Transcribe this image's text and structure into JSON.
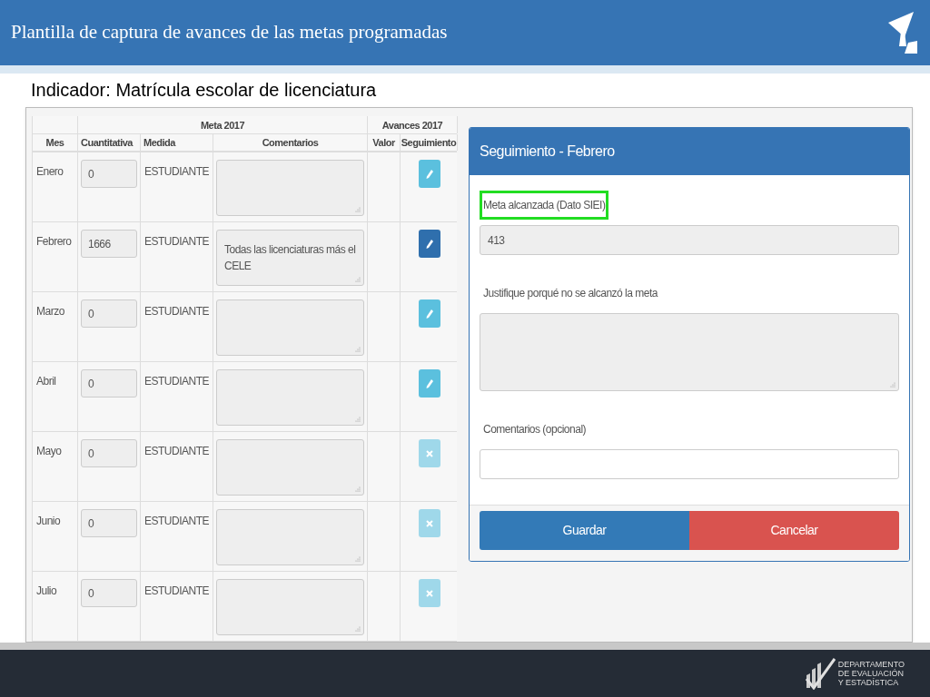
{
  "slide_title": "Plantilla de captura de avances de las metas programadas",
  "indicator": "Indicador: Matrícula escolar de licenciatura",
  "table": {
    "group_headers": [
      "Meta 2017",
      "Avances 2017"
    ],
    "columns": [
      "Mes",
      "Cuantitativa",
      "Medida",
      "Comentarios",
      "Valor",
      "Seguimiento"
    ],
    "rows": [
      {
        "mes": "Enero",
        "cuantitativa": "0",
        "medida": "ESTUDIANTE",
        "comentarios": "",
        "kind": "edit",
        "selected": false
      },
      {
        "mes": "Febrero",
        "cuantitativa": "1666",
        "medida": "ESTUDIANTE",
        "comentarios": "Todas las licenciaturas más el CELE",
        "kind": "edit",
        "selected": true
      },
      {
        "mes": "Marzo",
        "cuantitativa": "0",
        "medida": "ESTUDIANTE",
        "comentarios": "",
        "kind": "edit",
        "selected": false
      },
      {
        "mes": "Abril",
        "cuantitativa": "0",
        "medida": "ESTUDIANTE",
        "comentarios": "",
        "kind": "edit",
        "selected": false
      },
      {
        "mes": "Mayo",
        "cuantitativa": "0",
        "medida": "ESTUDIANTE",
        "comentarios": "",
        "kind": "blocked",
        "selected": false
      },
      {
        "mes": "Junio",
        "cuantitativa": "0",
        "medida": "ESTUDIANTE",
        "comentarios": "",
        "kind": "blocked",
        "selected": false
      },
      {
        "mes": "Julio",
        "cuantitativa": "0",
        "medida": "ESTUDIANTE",
        "comentarios": "",
        "kind": "blocked",
        "selected": false
      }
    ]
  },
  "panel": {
    "title": "Seguimiento - Febrero",
    "fields": [
      {
        "kind": "input",
        "label": "Meta alcanzada (Dato SIEI)",
        "value": "413",
        "highlighted": true,
        "disabled": true
      },
      {
        "kind": "textarea",
        "label": "Justifique porqué no se alcanzó la meta",
        "highlighted": false,
        "disabled": true
      },
      {
        "kind": "input",
        "label": "Comentarios (opcional)",
        "highlighted": false,
        "disabled": false
      }
    ],
    "buttons": [
      {
        "label": "Guardar",
        "kind": "primary"
      },
      {
        "label": "Cancelar",
        "kind": "danger"
      }
    ]
  },
  "footer_logo": [
    "DEPARTAMENTO",
    "DE EVALUACIÓN",
    "Y ESTADÍSTICA"
  ]
}
